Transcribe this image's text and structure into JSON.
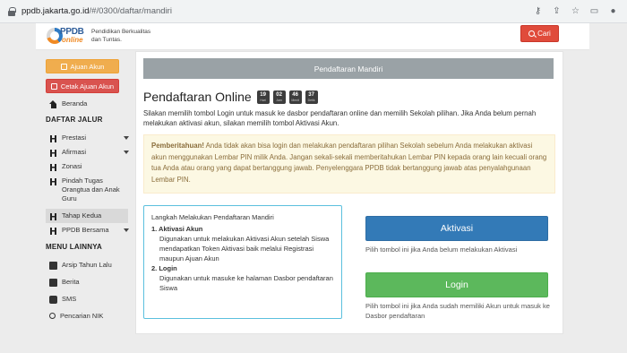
{
  "browser": {
    "url_domain": "ppdb.jakarta.go.id",
    "url_path": "/#/0300/daftar/mandiri"
  },
  "header": {
    "logo_text": "PPDB",
    "logo_sub": "online",
    "tagline_line1": "Pendidikan Berkualitas",
    "tagline_line2": "dan Tuntas.",
    "search_label": "Cari"
  },
  "sidebar": {
    "ajuan_akun": "Ajuan Akun",
    "cetak_ajuan_akun": "Cetak Ajuan Akun",
    "beranda": "Beranda",
    "daftar_jalur_title": "DAFTAR JALUR",
    "jalur": [
      {
        "label": "Prestasi",
        "caret": true
      },
      {
        "label": "Afirmasi",
        "caret": true
      },
      {
        "label": "Zonasi",
        "caret": false
      },
      {
        "label": "Pindah Tugas Orangtua dan Anak Guru",
        "caret": false
      },
      {
        "label": "Tahap Kedua",
        "caret": false
      },
      {
        "label": "PPDB Bersama",
        "caret": true
      }
    ],
    "menu_lainnya_title": "MENU LAINNYA",
    "lainnya": [
      "Arsip Tahun Lalu",
      "Berita",
      "SMS",
      "Pencarian NIK"
    ]
  },
  "main": {
    "banner": "Pendaftaran Mandiri",
    "title": "Pendaftaran Online",
    "countdown": [
      {
        "value": "19",
        "unit": "Hari"
      },
      {
        "value": "02",
        "unit": "Jam"
      },
      {
        "value": "46",
        "unit": "Menit"
      },
      {
        "value": "37",
        "unit": "Detik"
      }
    ],
    "intro": "Silakan memilih tombol Login untuk masuk ke dasbor pendaftaran online dan memilih Sekolah pilihan. Jika Anda belum pernah melakukan aktivasi akun, silakan memilih tombol Aktivasi Akun.",
    "alert_strong": "Pemberitahuan!",
    "alert_text": " Anda tidak akan bisa login dan melakukan pendaftaran pilihan Sekolah sebelum Anda melakukan aktivasi akun menggunakan Lembar PIN milik Anda. Jangan sekali-sekali memberitahukan Lembar PIN kepada orang lain kecuali orang tua Anda atau orang yang dapat bertanggung jawab. Penyelenggara PPDB tidak bertanggung jawab atas penyalahgunaan Lembar PIN.",
    "steps_title": "Langkah Melakukan Pendaftaran Mandiri",
    "step1_head": "1. Aktivasi Akun",
    "step1_desc": "Digunakan untuk melakukan Aktivasi Akun setelah Siswa mendapatkan Token Aktivasi baik melalui Registrasi maupun Ajuan Akun",
    "step2_head": "2. Login",
    "step2_desc": "Digunakan untuk masuke ke halaman Dasbor pendaftaran Siswa",
    "aktivasi_label": "Aktivasi",
    "aktivasi_hint": "Pilih tombol ini jika Anda belum melakukan Aktivasi",
    "login_label": "Login",
    "login_hint": "Pilih tombol ini jika Anda sudah memiliki Akun untuk masuk ke Dasbor pendaftaran"
  },
  "colors": {
    "primary": "#337ab7",
    "success": "#5cb85c",
    "danger": "#d9534f",
    "warning": "#f0ad4e",
    "banner": "#9aa2a6"
  }
}
